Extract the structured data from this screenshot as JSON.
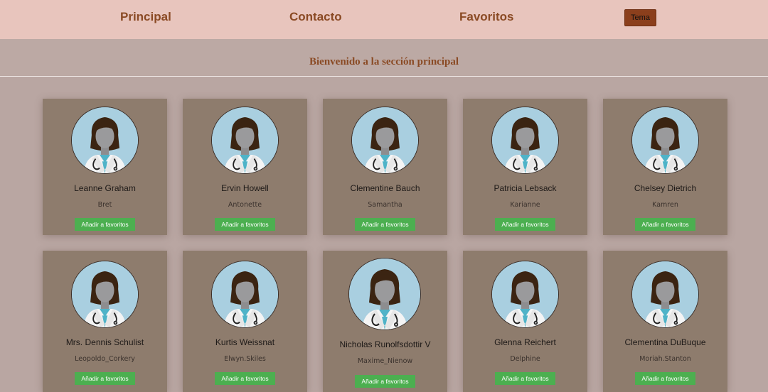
{
  "nav": {
    "principal": "Principal",
    "contacto": "Contacto",
    "favoritos": "Favoritos",
    "theme_button": "Tema"
  },
  "header": {
    "title": "Bienvenido a la sección principal"
  },
  "cards": {
    "fav_label": "Añadir a favoritos",
    "items": [
      {
        "name": "Leanne Graham",
        "username": "Bret"
      },
      {
        "name": "Ervin Howell",
        "username": "Antonette"
      },
      {
        "name": "Clementine Bauch",
        "username": "Samantha"
      },
      {
        "name": "Patricia Lebsack",
        "username": "Karianne"
      },
      {
        "name": "Chelsey Dietrich",
        "username": "Kamren"
      },
      {
        "name": "Mrs. Dennis Schulist",
        "username": "Leopoldo_Corkery"
      },
      {
        "name": "Kurtis Weissnat",
        "username": "Elwyn.Skiles"
      },
      {
        "name": "Nicholas Runolfsdottir V",
        "username": "Maxime_Nienow"
      },
      {
        "name": "Glenna Reichert",
        "username": "Delphine"
      },
      {
        "name": "Clementina DuBuque",
        "username": "Moriah.Stanton"
      }
    ]
  },
  "colors": {
    "navbar": "#e8c5bd",
    "accent_text": "#8a4a24",
    "theme_button": "#8b3f1c",
    "card": "#8e7c6d",
    "fav_button": "#4caf50",
    "avatar_bg": "#a9cfe0"
  }
}
